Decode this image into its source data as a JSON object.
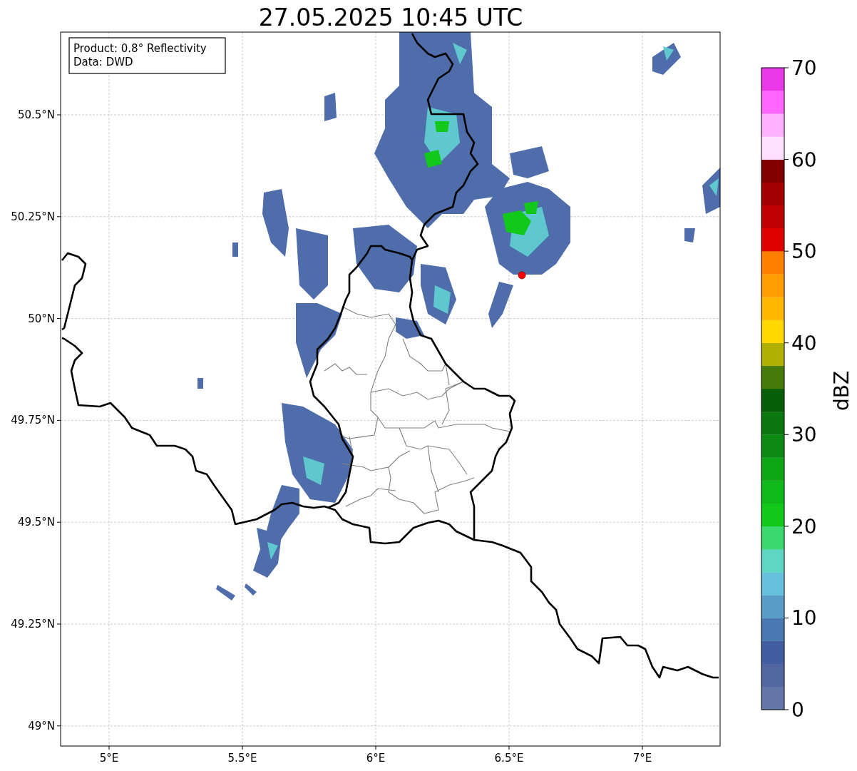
{
  "title": "27.05.2025 10:45 UTC",
  "info_box": {
    "lines": [
      "Product: 0.8° Reflectivity",
      "Data: DWD"
    ]
  },
  "map": {
    "x_ticks": [
      "5°E",
      "5.5°E",
      "6°E",
      "6.5°E",
      "7°E"
    ],
    "y_ticks": [
      "50.5°N",
      "50.25°N",
      "50°N",
      "49.75°N",
      "49.5°N",
      "49.25°N",
      "49°N"
    ]
  },
  "colorbar": {
    "label": "dBZ",
    "ticks": [
      "70",
      "60",
      "50",
      "40",
      "30",
      "20",
      "10",
      "0"
    ]
  }
}
